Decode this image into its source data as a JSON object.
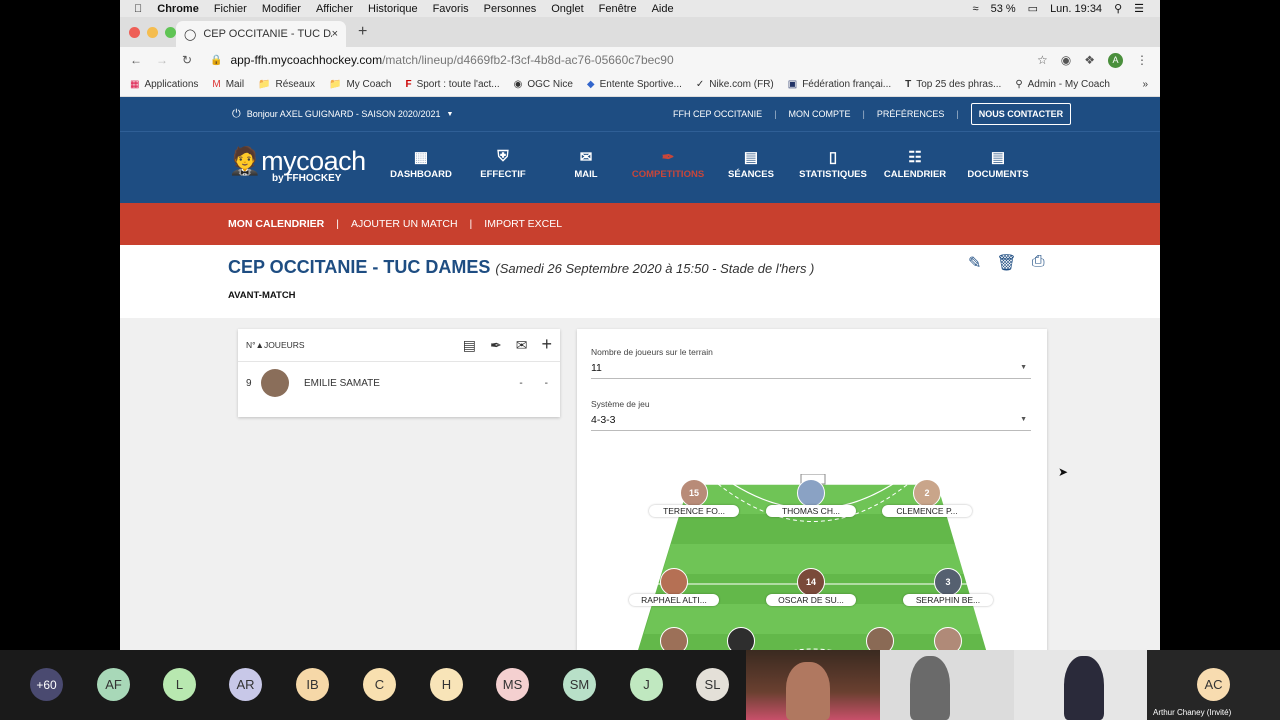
{
  "mac_menu": {
    "app": "Chrome",
    "items": [
      "Fichier",
      "Modifier",
      "Afficher",
      "Historique",
      "Favoris",
      "Personnes",
      "Onglet",
      "Fenêtre",
      "Aide"
    ],
    "battery": "53 %",
    "clock": "Lun. 19:34"
  },
  "browser": {
    "tab_title": "CEP OCCITANIE - TUC DAMES",
    "url_domain": "app-ffh.mycoachhockey.com",
    "url_path": "/match/lineup/d4669fb2-f3cf-4b8d-ac76-05660c7bec90",
    "profile_initial": "A",
    "bookmarks": [
      "Applications",
      "Mail",
      "Réseaux",
      "My Coach",
      "Sport : toute l'act...",
      "OGC Nice",
      "Entente Sportive...",
      "Nike.com (FR)",
      "Fédération françai...",
      "Top 25 des phras...",
      "Admin - My Coach"
    ]
  },
  "site": {
    "greeting": "Bonjour AXEL GUIGNARD - SAISON 2020/2021",
    "top_links": [
      "FFH CEP OCCITANIE",
      "MON COMPTE",
      "PRÉFÉRENCES"
    ],
    "contact_button": "NOUS CONTACTER",
    "logo_main": "mycoach",
    "logo_sub": "by FFHOCKEY",
    "nav": [
      {
        "label": "DASHBOARD",
        "icon": "grid-icon"
      },
      {
        "label": "EFFECTIF",
        "icon": "shield-icon"
      },
      {
        "label": "MAIL",
        "icon": "mail-icon"
      },
      {
        "label": "COMPETITIONS",
        "icon": "hockey-icon"
      },
      {
        "label": "SÉANCES",
        "icon": "clipboard-icon"
      },
      {
        "label": "STATISTIQUES",
        "icon": "chart-icon"
      },
      {
        "label": "CALENDRIER",
        "icon": "calendar-icon"
      },
      {
        "label": "DOCUMENTS",
        "icon": "document-icon"
      }
    ],
    "subnav": [
      "MON CALENDRIER",
      "AJOUTER UN MATCH",
      "IMPORT EXCEL"
    ],
    "match_title": "CEP OCCITANIE - TUC DAMES",
    "match_subtitle": "(Samedi 26 Septembre 2020 à 15:50 - Stade de l'hers )",
    "phase": "AVANT-MATCH",
    "list_header": "N°▲JOUEURS",
    "players_list": [
      {
        "num": "9",
        "name": "EMILIE SAMATE",
        "c1": "-",
        "c2": "-"
      }
    ],
    "field_players_label": "Nombre de joueurs sur le terrain",
    "field_players_value": "11",
    "system_label": "Système de jeu",
    "system_value": "4-3-3",
    "pitch_players": [
      {
        "name": "TERENCE FO...",
        "num": "15"
      },
      {
        "name": "THOMAS CH...",
        "num": ""
      },
      {
        "name": "CLEMENCE P...",
        "num": "2"
      },
      {
        "name": "RAPHAEL ALTI...",
        "num": ""
      },
      {
        "name": "OSCAR DE SU...",
        "num": "14"
      },
      {
        "name": "SERAPHIN BE...",
        "num": "3"
      }
    ]
  },
  "meeting": {
    "participants": [
      "+60",
      "AF",
      "L",
      "AR",
      "IB",
      "C",
      "H",
      "MS",
      "SM",
      "J",
      "SL"
    ],
    "last": {
      "initials": "AC",
      "name": "Arthur Chaney (Invité)"
    }
  }
}
